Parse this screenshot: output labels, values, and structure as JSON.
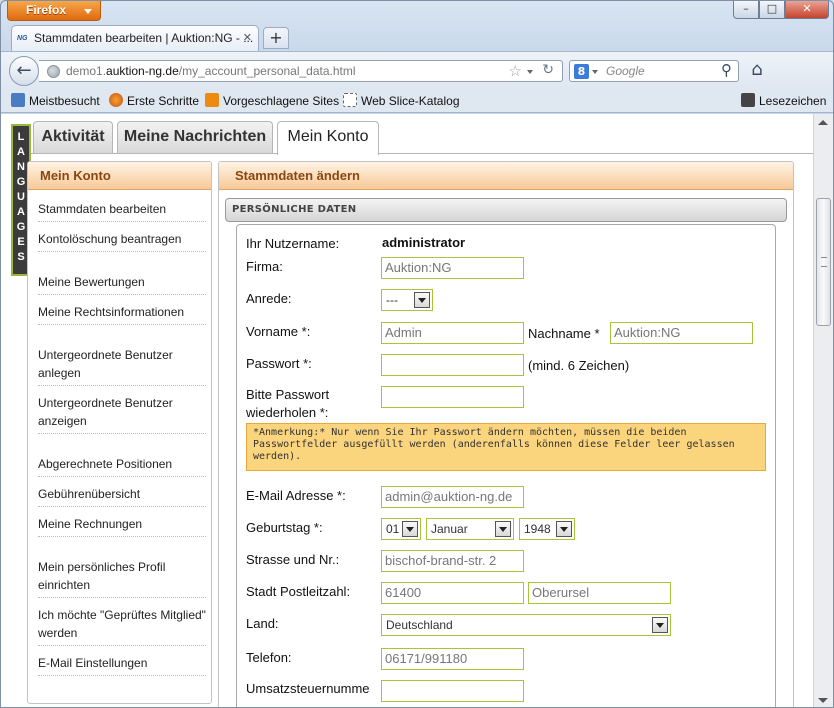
{
  "browser": {
    "app_button": "Firefox",
    "tab_title": "Stammdaten bearbeiten | Auktion:NG - ...",
    "tab_favicon": "NG",
    "url_prefix": "demo1.",
    "url_domain": "auktion-ng.de",
    "url_path": "/my_account_personal_data.html",
    "search_placeholder": "Google",
    "search_engine_letter": "8"
  },
  "bookmarks": {
    "items": [
      "Meistbesucht",
      "Erste Schritte",
      "Vorgeschlagene Sites",
      "Web Slice-Katalog"
    ],
    "right": "Lesezeichen"
  },
  "languages_label": [
    "L",
    "A",
    "N",
    "G",
    "U",
    "A",
    "G",
    "E",
    "S"
  ],
  "site_tabs": [
    "Aktivität",
    "Meine Nachrichten",
    "Mein Konto"
  ],
  "sidebar": {
    "title": "Mein Konto",
    "items": [
      "Stammdaten bearbeiten",
      "Kontolöschung beantragen",
      "Meine Bewertungen",
      "Meine Rechtsinformationen",
      "Untergeordnete Benutzer anlegen",
      "Untergeordnete Benutzer anzeigen",
      "Abgerechnete Positionen",
      "Gebührenübersicht",
      "Meine Rechnungen",
      "Mein persönliches Profil einrichten",
      "Ich möchte \"Geprüftes Mitglied\" werden",
      "E-Mail Einstellungen"
    ]
  },
  "main": {
    "title": "Stammdaten ändern",
    "section": "PERSÖNLICHE DATEN",
    "labels": {
      "username": "Ihr Nutzername:",
      "firma": "Firma:",
      "anrede": "Anrede:",
      "vorname": "Vorname *:",
      "nachname": "Nachname *",
      "passwort": "Passwort *:",
      "passwort_hint": "(mind. 6 Zeichen)",
      "passwort_repeat_1": "Bitte Passwort",
      "passwort_repeat_2": "wiederholen *:",
      "email": "E-Mail Adresse *:",
      "geburtstag": "Geburtstag *:",
      "strasse": "Strasse und Nr.:",
      "stadt": "Stadt Postleitzahl:",
      "land": "Land:",
      "telefon": "Telefon:",
      "ust": "Umsatzsteuernumme"
    },
    "values": {
      "username": "administrator",
      "firma": "Auktion:NG",
      "anrede": "---",
      "vorname": "Admin",
      "nachname": "Auktion:NG",
      "passwort": "",
      "passwort_repeat": "",
      "email": "admin@auktion-ng.de",
      "geb_tag": "01",
      "geb_monat": "Januar",
      "geb_jahr": "1948",
      "strasse": "bischof-brand-str. 2",
      "plz": "61400",
      "stadt": "Oberursel",
      "land": "Deutschland",
      "telefon": "06171/991180",
      "ust": ""
    },
    "note": "*Anmerkung:* Nur wenn Sie Ihr Passwort ändern möchten, müssen die beiden Passwortfelder ausgefüllt werden (anderenfalls können diese Felder leer gelassen werden)."
  }
}
